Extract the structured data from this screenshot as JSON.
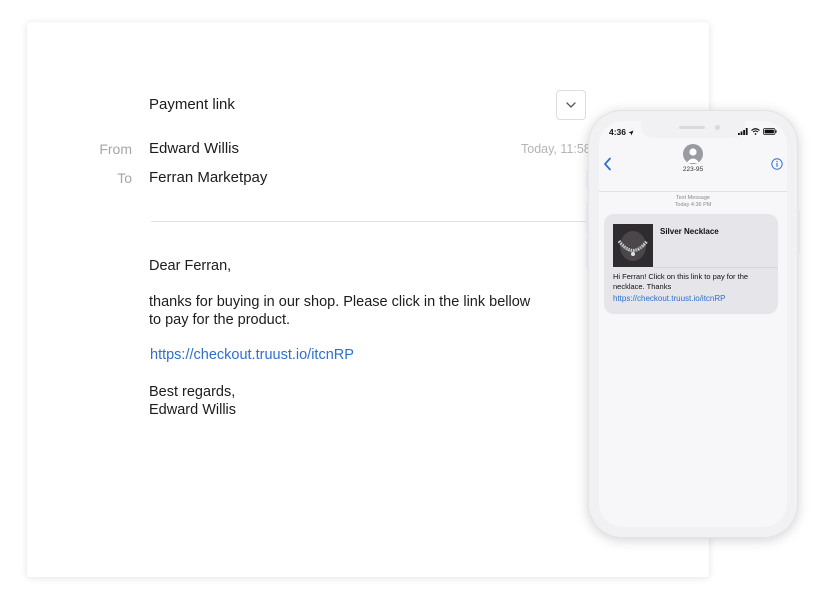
{
  "email": {
    "subject": "Payment link",
    "from_label": "From",
    "from_value": "Edward Willis",
    "to_label": "To",
    "to_value": "Ferran Marketpay",
    "timestamp": "Today, 11:58",
    "greeting": "Dear Ferran,",
    "body_line1": "thanks for buying in our shop. Please click in the link bellow",
    "body_line2": "to pay for the product.",
    "link": "https://checkout.truust.io/itcnRP",
    "closing": "Best regards,",
    "signature": "Edward Willis",
    "expand_icon": "chevron-down-icon"
  },
  "phone": {
    "status_time": "4:36",
    "contact_name": "223-95",
    "message_type": "Text Message",
    "message_time": "Today 4:36 PM",
    "card_title": "Silver Necklace",
    "message_text": "Hi Ferran! Click on this link to pay for the necklace. Thanks",
    "message_link": "https://checkout.truust.io/itcnRP",
    "icons": [
      "location-arrow-icon",
      "signal-icon",
      "wifi-icon",
      "battery-icon",
      "back-chevron-icon",
      "info-icon",
      "contact-avatar-icon"
    ]
  },
  "colors": {
    "link": "#2f6fd0",
    "muted": "#a6a6a6",
    "bubble": "#e5e5ea"
  }
}
